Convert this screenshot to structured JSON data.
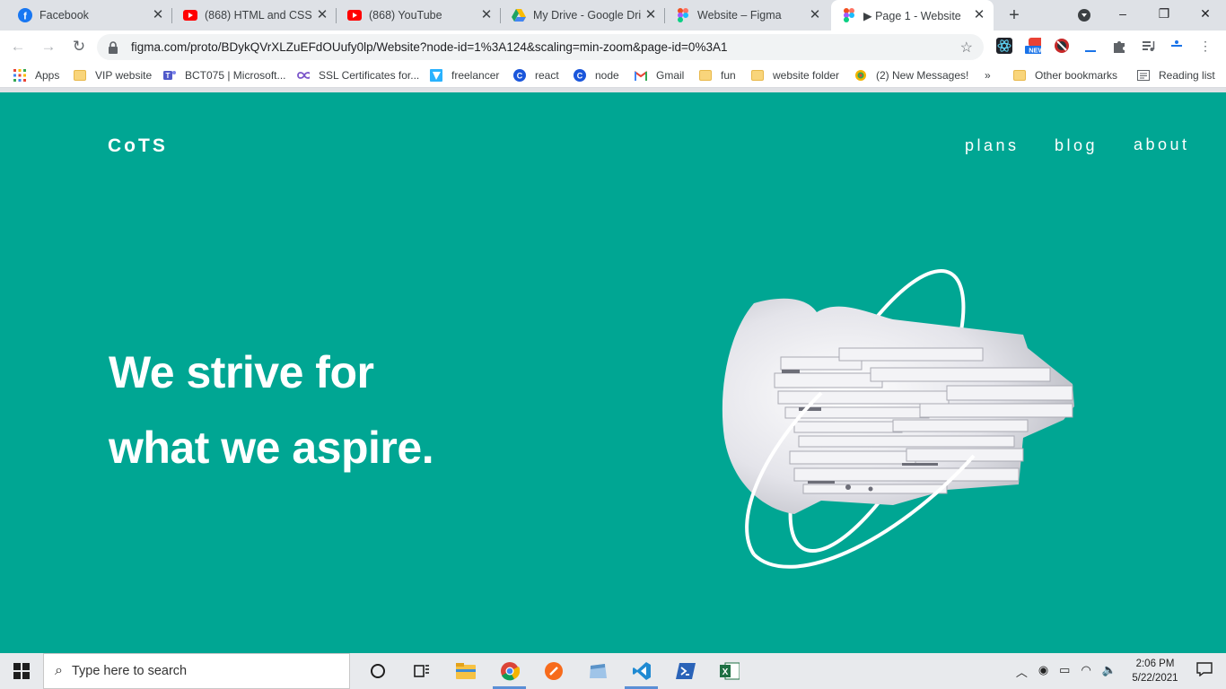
{
  "browser": {
    "tabs": [
      {
        "title": "Facebook",
        "icon": "facebook-icon",
        "color": "#1877f2",
        "active": false
      },
      {
        "title": "(868) HTML and CSS T",
        "icon": "youtube-icon",
        "color": "#ff0000",
        "active": false
      },
      {
        "title": "(868) YouTube",
        "icon": "youtube-icon",
        "color": "#ff0000",
        "active": false
      },
      {
        "title": "My Drive - Google Dri",
        "icon": "google-drive-icon",
        "color": "#fbbc04",
        "active": false
      },
      {
        "title": "Website – Figma",
        "icon": "figma-icon",
        "color": "#f24e1e",
        "active": false
      },
      {
        "title": "▶ Page 1 - Website",
        "icon": "figma-icon",
        "color": "#f24e1e",
        "active": true
      }
    ],
    "new_tab": "+",
    "window_controls": {
      "minimize": "–",
      "restore": "❐",
      "close": "✕"
    },
    "nav": {
      "back": "←",
      "forward": "→",
      "reload": "↻"
    },
    "url": "figma.com/proto/BDykQVrXLZuEFdOUufy0lp/Website?node-id=1%3A124&scaling=min-zoom&page-id=0%3A1",
    "bookmark_star": "☆",
    "bookmarks": [
      {
        "label": "Apps",
        "icon": "apps-grid-icon"
      },
      {
        "label": "VIP website",
        "icon": "folder-icon"
      },
      {
        "label": "BCT075 | Microsoft...",
        "icon": "teams-icon"
      },
      {
        "label": "SSL Certificates for...",
        "icon": "infinity-icon"
      },
      {
        "label": "freelancer",
        "icon": "freelancer-icon"
      },
      {
        "label": "react",
        "icon": "c-logo-icon"
      },
      {
        "label": "node",
        "icon": "c-logo-icon"
      },
      {
        "label": "Gmail",
        "icon": "gmail-icon"
      },
      {
        "label": "fun",
        "icon": "folder-icon"
      },
      {
        "label": "website folder",
        "icon": "folder-icon"
      },
      {
        "label": "(2) New Messages!",
        "icon": "messages-icon"
      }
    ],
    "bookmarks_overflow": "»",
    "other_bookmarks": "Other bookmarks",
    "reading_list": "Reading list"
  },
  "site": {
    "logo": "CoTS",
    "nav": {
      "plans": "plans",
      "blog": "blog",
      "about": "about"
    },
    "headline": {
      "line1": "We strive for",
      "line2": "what we aspire."
    },
    "hero_image": "abstract-white-sculpture-with-orbit-ring",
    "colors": {
      "background": "#00a693",
      "text": "#ffffff"
    }
  },
  "taskbar": {
    "search_placeholder": "Type here to search",
    "apps": [
      "cortana-icon",
      "task-view-icon",
      "file-explorer-icon",
      "chrome-icon",
      "app-orange-icon",
      "app-window-icon",
      "vscode-icon",
      "powershell-icon",
      "excel-icon"
    ],
    "time": "2:06 PM",
    "date": "5/22/2021"
  }
}
